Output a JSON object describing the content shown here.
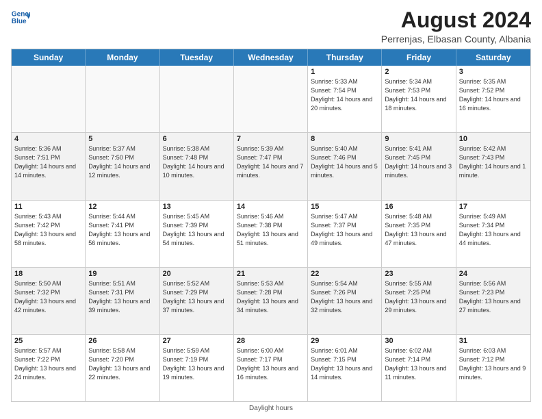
{
  "header": {
    "logo_line1": "General",
    "logo_line2": "Blue",
    "month_title": "August 2024",
    "location": "Perrenjas, Elbasan County, Albania"
  },
  "days_of_week": [
    "Sunday",
    "Monday",
    "Tuesday",
    "Wednesday",
    "Thursday",
    "Friday",
    "Saturday"
  ],
  "footer": {
    "daylight_label": "Daylight hours"
  },
  "weeks": [
    [
      {
        "day": "",
        "content": ""
      },
      {
        "day": "",
        "content": ""
      },
      {
        "day": "",
        "content": ""
      },
      {
        "day": "",
        "content": ""
      },
      {
        "day": "1",
        "content": "Sunrise: 5:33 AM\nSunset: 7:54 PM\nDaylight: 14 hours and 20 minutes."
      },
      {
        "day": "2",
        "content": "Sunrise: 5:34 AM\nSunset: 7:53 PM\nDaylight: 14 hours and 18 minutes."
      },
      {
        "day": "3",
        "content": "Sunrise: 5:35 AM\nSunset: 7:52 PM\nDaylight: 14 hours and 16 minutes."
      }
    ],
    [
      {
        "day": "4",
        "content": "Sunrise: 5:36 AM\nSunset: 7:51 PM\nDaylight: 14 hours and 14 minutes."
      },
      {
        "day": "5",
        "content": "Sunrise: 5:37 AM\nSunset: 7:50 PM\nDaylight: 14 hours and 12 minutes."
      },
      {
        "day": "6",
        "content": "Sunrise: 5:38 AM\nSunset: 7:48 PM\nDaylight: 14 hours and 10 minutes."
      },
      {
        "day": "7",
        "content": "Sunrise: 5:39 AM\nSunset: 7:47 PM\nDaylight: 14 hours and 7 minutes."
      },
      {
        "day": "8",
        "content": "Sunrise: 5:40 AM\nSunset: 7:46 PM\nDaylight: 14 hours and 5 minutes."
      },
      {
        "day": "9",
        "content": "Sunrise: 5:41 AM\nSunset: 7:45 PM\nDaylight: 14 hours and 3 minutes."
      },
      {
        "day": "10",
        "content": "Sunrise: 5:42 AM\nSunset: 7:43 PM\nDaylight: 14 hours and 1 minute."
      }
    ],
    [
      {
        "day": "11",
        "content": "Sunrise: 5:43 AM\nSunset: 7:42 PM\nDaylight: 13 hours and 58 minutes."
      },
      {
        "day": "12",
        "content": "Sunrise: 5:44 AM\nSunset: 7:41 PM\nDaylight: 13 hours and 56 minutes."
      },
      {
        "day": "13",
        "content": "Sunrise: 5:45 AM\nSunset: 7:39 PM\nDaylight: 13 hours and 54 minutes."
      },
      {
        "day": "14",
        "content": "Sunrise: 5:46 AM\nSunset: 7:38 PM\nDaylight: 13 hours and 51 minutes."
      },
      {
        "day": "15",
        "content": "Sunrise: 5:47 AM\nSunset: 7:37 PM\nDaylight: 13 hours and 49 minutes."
      },
      {
        "day": "16",
        "content": "Sunrise: 5:48 AM\nSunset: 7:35 PM\nDaylight: 13 hours and 47 minutes."
      },
      {
        "day": "17",
        "content": "Sunrise: 5:49 AM\nSunset: 7:34 PM\nDaylight: 13 hours and 44 minutes."
      }
    ],
    [
      {
        "day": "18",
        "content": "Sunrise: 5:50 AM\nSunset: 7:32 PM\nDaylight: 13 hours and 42 minutes."
      },
      {
        "day": "19",
        "content": "Sunrise: 5:51 AM\nSunset: 7:31 PM\nDaylight: 13 hours and 39 minutes."
      },
      {
        "day": "20",
        "content": "Sunrise: 5:52 AM\nSunset: 7:29 PM\nDaylight: 13 hours and 37 minutes."
      },
      {
        "day": "21",
        "content": "Sunrise: 5:53 AM\nSunset: 7:28 PM\nDaylight: 13 hours and 34 minutes."
      },
      {
        "day": "22",
        "content": "Sunrise: 5:54 AM\nSunset: 7:26 PM\nDaylight: 13 hours and 32 minutes."
      },
      {
        "day": "23",
        "content": "Sunrise: 5:55 AM\nSunset: 7:25 PM\nDaylight: 13 hours and 29 minutes."
      },
      {
        "day": "24",
        "content": "Sunrise: 5:56 AM\nSunset: 7:23 PM\nDaylight: 13 hours and 27 minutes."
      }
    ],
    [
      {
        "day": "25",
        "content": "Sunrise: 5:57 AM\nSunset: 7:22 PM\nDaylight: 13 hours and 24 minutes."
      },
      {
        "day": "26",
        "content": "Sunrise: 5:58 AM\nSunset: 7:20 PM\nDaylight: 13 hours and 22 minutes."
      },
      {
        "day": "27",
        "content": "Sunrise: 5:59 AM\nSunset: 7:19 PM\nDaylight: 13 hours and 19 minutes."
      },
      {
        "day": "28",
        "content": "Sunrise: 6:00 AM\nSunset: 7:17 PM\nDaylight: 13 hours and 16 minutes."
      },
      {
        "day": "29",
        "content": "Sunrise: 6:01 AM\nSunset: 7:15 PM\nDaylight: 13 hours and 14 minutes."
      },
      {
        "day": "30",
        "content": "Sunrise: 6:02 AM\nSunset: 7:14 PM\nDaylight: 13 hours and 11 minutes."
      },
      {
        "day": "31",
        "content": "Sunrise: 6:03 AM\nSunset: 7:12 PM\nDaylight: 13 hours and 9 minutes."
      }
    ]
  ]
}
